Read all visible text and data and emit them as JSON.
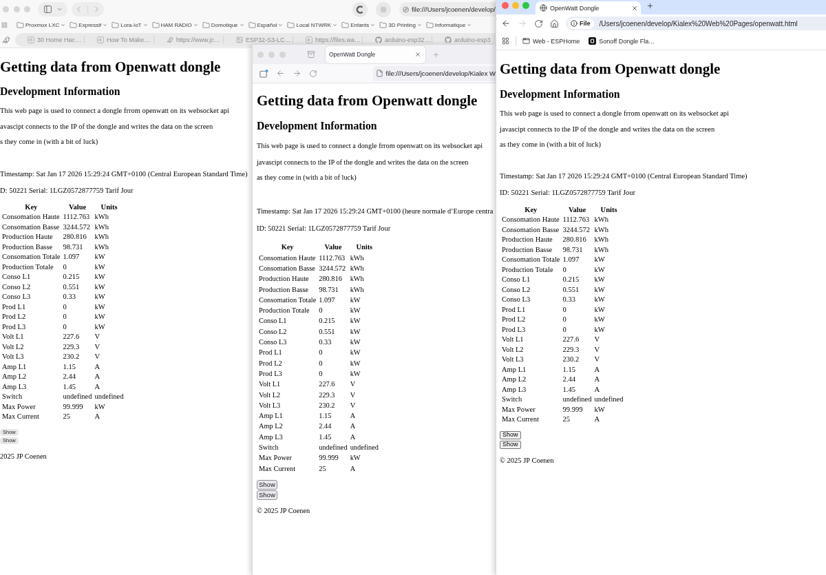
{
  "windows": [
    {
      "kind": "safari",
      "focused": false,
      "nav": {
        "back_disabled": true,
        "forward_disabled": true
      },
      "address": "file:///Users/jcoenen/develop/",
      "bookmarks": [
        "Proxmox LXC",
        "Expressif",
        "Lora-IoT",
        "HAM RADIO",
        "Domotique",
        "Español",
        "Local NTWRK",
        "Enfants",
        "3D Printing",
        "Informatique"
      ],
      "tabs": [
        {
          "title": "30 Home Hac…",
          "selected": false
        },
        {
          "title": "How To Make…",
          "selected": false
        },
        {
          "title": "https://www.jc…",
          "selected": false
        },
        {
          "title": "ESP32-S3-LC…",
          "selected": false
        },
        {
          "title": "https://files.wa…",
          "selected": false
        },
        {
          "title": "arduino-esp32…",
          "selected": false
        },
        {
          "title": "arduino-esp3",
          "selected": false
        }
      ],
      "page": {
        "title": "Getting data from Openwatt dongle",
        "subtitle": "Development Information",
        "paragraphs": [
          "This web page is used to connect a dongle frrom openwatt on its websocket api",
          "avascipt connects to the IP of the dongle and writes the data on the screen",
          "s they come in (with a bit of luck)"
        ],
        "timestamp": "Timestamp: Sat Jan 17 2026 15:29:24 GMT+0100 (Central European Standard Time)",
        "device_line": "D: 50221 Serial: 1LGZ0572877759 Tarif Jour",
        "table": {
          "columns": [
            "Key",
            "Value",
            "Units"
          ],
          "rows": [
            [
              "Consomation Haute",
              "1112.763",
              "kWh"
            ],
            [
              "Consomation Basse",
              "3244.572",
              "kWh"
            ],
            [
              "Production Haute",
              "280.816",
              "kWh"
            ],
            [
              "Production Basse",
              "98.731",
              "kWh"
            ],
            [
              "Consomation Totale",
              "1.097",
              "kW"
            ],
            [
              "Production Totale",
              "0",
              "kW"
            ],
            [
              "Conso L1",
              "0.215",
              "kW"
            ],
            [
              "Conso L2",
              "0.551",
              "kW"
            ],
            [
              "Conso L3",
              "0.33",
              "kW"
            ],
            [
              "Prod L1",
              "0",
              "kW"
            ],
            [
              "Prod L2",
              "0",
              "kW"
            ],
            [
              "Prod L3",
              "0",
              "kW"
            ],
            [
              "Volt L1",
              "227.6",
              "V"
            ],
            [
              "Volt L2",
              "229.3",
              "V"
            ],
            [
              "Volt L3",
              "230.2",
              "V"
            ],
            [
              "Amp L1",
              "1.15",
              "A"
            ],
            [
              "Amp L2",
              "2.44",
              "A"
            ],
            [
              "Amp L3",
              "1.45",
              "A"
            ],
            [
              "Switch",
              "undefined",
              "undefined"
            ],
            [
              "Max Power",
              "99.999",
              "kW"
            ],
            [
              "Max Current",
              "25",
              "A"
            ]
          ]
        },
        "buttons": [
          "Show",
          "Show"
        ],
        "footer": "2025 JP Coenen"
      }
    },
    {
      "kind": "firefox",
      "focused": false,
      "nav": {
        "back_disabled": false,
        "forward_disabled": false
      },
      "address": "file:///Users/jcoenen/develop/Kialex W",
      "tabs": [
        {
          "title": "OpenWatt Dongle",
          "selected": true
        }
      ],
      "page": {
        "title": "Getting data from Openwatt dongle",
        "subtitle": "Development Information",
        "paragraphs": [
          "This web page is used to connect a dongle frrom openwatt on its websocket api",
          "javascipt connects to the IP of the dongle and writes the data on the screen",
          "as they come in (with a bit of luck)"
        ],
        "timestamp": "Timestamp: Sat Jan 17 2026 15:29:24 GMT+0100 (heure normale d’Europe centra",
        "device_line": "ID: 50221 Serial: 1LGZ0572877759 Tarif Jour",
        "table": {
          "columns": [
            "Key",
            "Value",
            "Units"
          ],
          "rows": [
            [
              "Consomation Haute",
              "1112.763",
              "kWh"
            ],
            [
              "Consomation Basse",
              "3244.572",
              "kWh"
            ],
            [
              "Production Haute",
              "280.816",
              "kWh"
            ],
            [
              "Production Basse",
              "98.731",
              "kWh"
            ],
            [
              "Consomation Totale",
              "1.097",
              "kW"
            ],
            [
              "Production Totale",
              "0",
              "kW"
            ],
            [
              "Conso L1",
              "0.215",
              "kW"
            ],
            [
              "Conso L2",
              "0.551",
              "kW"
            ],
            [
              "Conso L3",
              "0.33",
              "kW"
            ],
            [
              "Prod L1",
              "0",
              "kW"
            ],
            [
              "Prod L2",
              "0",
              "kW"
            ],
            [
              "Prod L3",
              "0",
              "kW"
            ],
            [
              "Volt L1",
              "227.6",
              "V"
            ],
            [
              "Volt L2",
              "229.3",
              "V"
            ],
            [
              "Volt L3",
              "230.2",
              "V"
            ],
            [
              "Amp L1",
              "1.15",
              "A"
            ],
            [
              "Amp L2",
              "2.44",
              "A"
            ],
            [
              "Amp L3",
              "1.45",
              "A"
            ],
            [
              "Switch",
              "undefined",
              "undefined"
            ],
            [
              "Max Power",
              "99.999",
              "kW"
            ],
            [
              "Max Current",
              "25",
              "A"
            ]
          ]
        },
        "buttons": [
          "Show",
          "Show"
        ],
        "footer": "© 2025 JP Coenen"
      }
    },
    {
      "kind": "chrome",
      "focused": true,
      "nav": {
        "back_disabled": false,
        "forward_disabled": true
      },
      "address_chip": "File",
      "address": "/Users/jcoenen/develop/Kialex%20Web%20Pages/openwatt.html",
      "bookmarks": [
        "Web - ESPHome",
        "Sonoff Dongle Fla…"
      ],
      "tabs": [
        {
          "title": "OpenWatt Dongle",
          "selected": true
        }
      ],
      "page": {
        "title": "Getting data from Openwatt dongle",
        "subtitle": "Development Information",
        "paragraphs": [
          "This web page is used to connect a dongle frrom openwatt on its websocket api",
          "javascipt connects to the IP of the dongle and writes the data on the screen",
          "as they come in (with a bit of luck)"
        ],
        "timestamp": "Timestamp: Sat Jan 17 2026 15:29:24 GMT+0100 (Central European Standard Time)",
        "device_line": "ID: 50221 Serial: 1LGZ0572877759 Tarif Jour",
        "table": {
          "columns": [
            "Key",
            "Value",
            "Units"
          ],
          "rows": [
            [
              "Consomation Haute",
              "1112.763",
              "kWh"
            ],
            [
              "Consomation Basse",
              "3244.572",
              "kWh"
            ],
            [
              "Production Haute",
              "280.816",
              "kWh"
            ],
            [
              "Production Basse",
              "98.731",
              "kWh"
            ],
            [
              "Consomation Totale",
              "1.097",
              "kW"
            ],
            [
              "Production Totale",
              "0",
              "kW"
            ],
            [
              "Conso L1",
              "0.215",
              "kW"
            ],
            [
              "Conso L2",
              "0.551",
              "kW"
            ],
            [
              "Conso L3",
              "0.33",
              "kW"
            ],
            [
              "Prod L1",
              "0",
              "kW"
            ],
            [
              "Prod L2",
              "0",
              "kW"
            ],
            [
              "Prod L3",
              "0",
              "kW"
            ],
            [
              "Volt L1",
              "227.6",
              "V"
            ],
            [
              "Volt L2",
              "229.3",
              "V"
            ],
            [
              "Volt L3",
              "230.2",
              "V"
            ],
            [
              "Amp L1",
              "1.15",
              "A"
            ],
            [
              "Amp L2",
              "2.44",
              "A"
            ],
            [
              "Amp L3",
              "1.45",
              "A"
            ],
            [
              "Switch",
              "undefined",
              "undefined"
            ],
            [
              "Max Power",
              "99.999",
              "kW"
            ],
            [
              "Max Current",
              "25",
              "A"
            ]
          ]
        },
        "buttons": [
          "Show",
          "Show"
        ],
        "footer": "© 2025 JP Coenen"
      }
    }
  ]
}
